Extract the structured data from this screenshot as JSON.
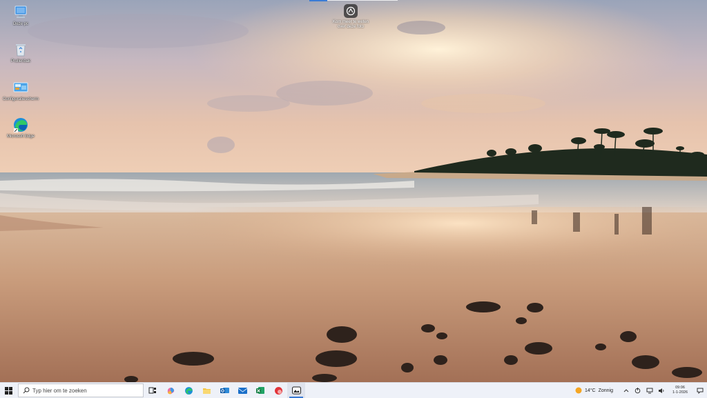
{
  "desktop": {
    "icons": [
      {
        "name": "this-pc",
        "label": "Deze pc"
      },
      {
        "name": "recycle-bin",
        "label": "Prullenbak"
      },
      {
        "name": "control-panel",
        "label": "Configuratiescherm"
      },
      {
        "name": "edge",
        "label": "Microsoft Edge"
      }
    ],
    "info_widget": {
      "label": "Kom meer te weten over deze foto"
    }
  },
  "taskbar": {
    "search_placeholder": "Typ hier om te zoeken",
    "apps": [
      "task-view",
      "copilot",
      "edge",
      "file-explorer",
      "outlook",
      "mail",
      "excel",
      "app-red",
      "photos"
    ],
    "active_app": "photos",
    "weather": {
      "temp": "14°C",
      "condition": "Zonnig"
    },
    "clock": {
      "time": "09:06",
      "date": "1-1-2026"
    }
  },
  "colors": {
    "accent": "#3a7bd5",
    "taskbar_bg": "#eef1f8"
  }
}
